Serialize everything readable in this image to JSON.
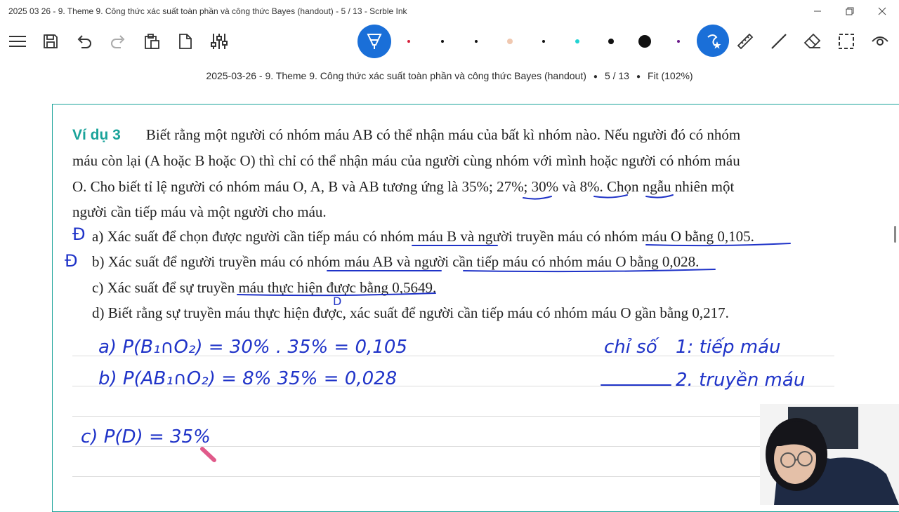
{
  "window": {
    "title": "2025 03 26 - 9. Theme 9. Công thức xác suất toàn phần và công thức Bayes (handout) - 5 / 13 - Scrble Ink"
  },
  "status": {
    "doc_title": "2025-03-26 - 9. Theme 9. Công thức xác suất toàn phần và công thức Bayes (handout)",
    "page": "5 / 13",
    "zoom": "Fit (102%)"
  },
  "pen_colors": [
    "#d6203a",
    "#111111",
    "#111111",
    "#f0c8b0",
    "#111111",
    "#22d3d3",
    "#111111",
    "#111111",
    "#6a1a8a"
  ],
  "document": {
    "example_label": "Ví dụ 3",
    "intro_l1": "Biết rằng một người có nhóm máu AB có thể nhận máu của bất kì nhóm nào. Nếu người đó có nhóm",
    "intro_l2": "máu còn lại (A hoặc B hoặc O) thì chỉ có thể nhận máu của người cùng nhóm với mình hoặc người có nhóm máu",
    "intro_l3": "O. Cho biết tỉ lệ người có nhóm máu O, A, B và AB tương ứng là 35%; 27%; 30% và 8%. Chọn ngẫu nhiên một",
    "intro_l4": "người cần tiếp máu và một người cho máu.",
    "item_a": "a) Xác suất để chọn được người cần tiếp máu có nhóm máu B và người truyền máu có nhóm máu O bằng 0,105.",
    "item_b": "b) Xác suất để người truyền máu có nhóm máu AB và người cần tiếp máu có nhóm máu O bằng 0,028.",
    "item_c": "c) Xác suất để sự truyền máu thực hiện được bằng 0,5649.",
    "item_d": "d) Biết rằng sự truyền máu thực hiện được, xác suất để người cần tiếp máu có nhóm máu O gần bằng 0,217."
  },
  "handwriting": {
    "mark_a": "Đ",
    "mark_b": "Đ",
    "mark_d": "D",
    "line_a": "a)   P(B₁∩O₂) = 30% . 35% = 0,105",
    "line_b": "b)   P(AB₁∩O₂) = 8% 35% = 0,028",
    "line_c": "c)   P(D) = 35%",
    "note_title": "chỉ số",
    "note_1": "1: tiếp máu",
    "note_2": "2. truyền máu"
  }
}
